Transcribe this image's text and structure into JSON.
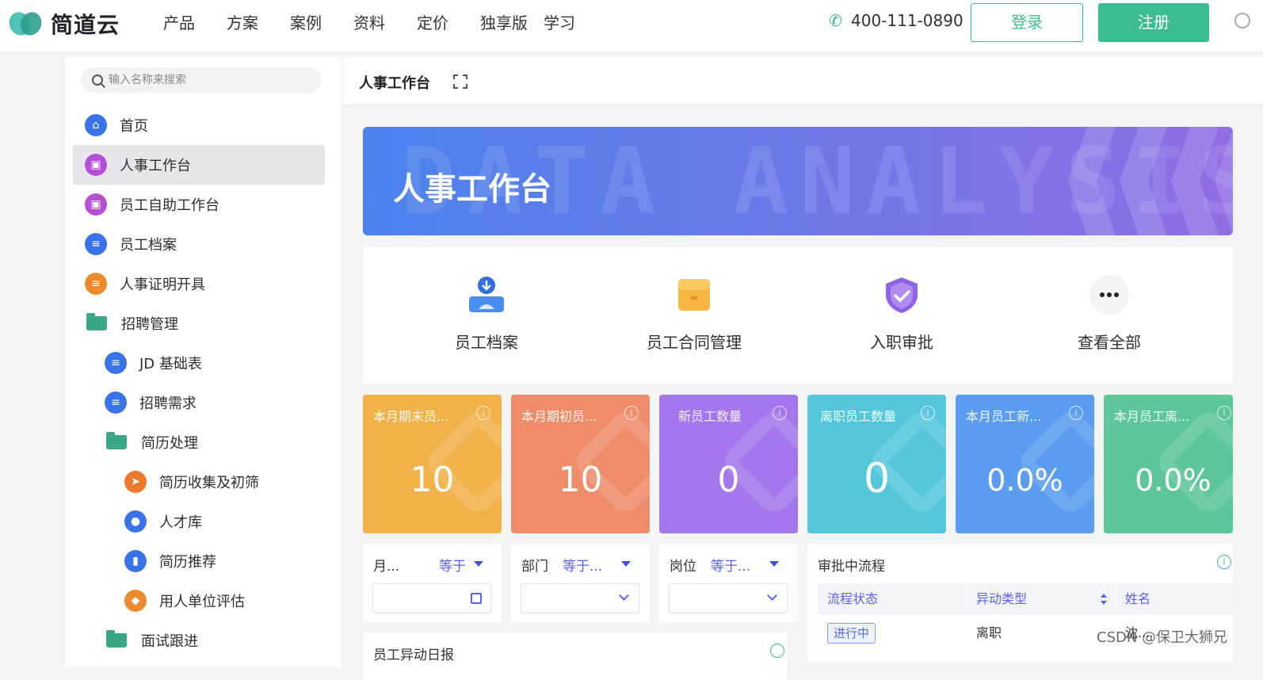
{
  "brand": {
    "name": "简道云"
  },
  "nav": [
    "产品",
    "方案",
    "案例",
    "资料",
    "定价",
    "独享版",
    "学习"
  ],
  "phone": "400-111-0890",
  "login_label": "登录",
  "register_label": "注册",
  "sidebar": {
    "search_placeholder": "输入名称来搜索",
    "items": [
      {
        "label": "首页",
        "icon": "home-icon",
        "color": "#3a73e8"
      },
      {
        "label": "人事工作台",
        "icon": "dashboard-icon",
        "color": "#b44fd6"
      },
      {
        "label": "员工自助工作台",
        "icon": "dashboard-icon",
        "color": "#b44fd6"
      },
      {
        "label": "员工档案",
        "icon": "form-icon",
        "color": "#3a73e8"
      },
      {
        "label": "人事证明开具",
        "icon": "form-icon",
        "color": "#ec8a2e"
      },
      {
        "label": "招聘管理",
        "icon": "folder-icon",
        "color": "#3aa787"
      },
      {
        "label": "JD 基础表",
        "icon": "form-icon",
        "color": "#3a73e8"
      },
      {
        "label": "招聘需求",
        "icon": "form-icon",
        "color": "#3a73e8"
      },
      {
        "label": "简历处理",
        "icon": "folder-icon",
        "color": "#3aa787"
      },
      {
        "label": "简历收集及初筛",
        "icon": "send-icon",
        "color": "#ec7a2e"
      },
      {
        "label": "人才库",
        "icon": "person-icon",
        "color": "#3a73e8"
      },
      {
        "label": "简历推荐",
        "icon": "bookmark-icon",
        "color": "#3a73e8"
      },
      {
        "label": "用人单位评估",
        "icon": "tag-icon",
        "color": "#ec8a2e"
      },
      {
        "label": "面试跟进",
        "icon": "folder-icon",
        "color": "#3aa787"
      }
    ]
  },
  "content": {
    "title": "人事工作台",
    "banner_title": "人事工作台",
    "banner_bg_text": "DATA ANALYSIS",
    "quick_links": [
      {
        "label": "员工档案",
        "icon": "download-person-icon"
      },
      {
        "label": "员工合同管理",
        "icon": "folder-box-icon"
      },
      {
        "label": "入职审批",
        "icon": "shield-check-icon"
      },
      {
        "label": "查看全部",
        "icon": "more-icon"
      }
    ],
    "metrics": [
      {
        "label": "本月期末员...",
        "value": "10",
        "color": "#f1b24a"
      },
      {
        "label": "本月期初员...",
        "value": "10",
        "color": "#ef8d6b"
      },
      {
        "label": "新员工数量",
        "value": "0",
        "color": "#a478ec"
      },
      {
        "label": "离职员工数量",
        "value": "0",
        "color": "#56c6dc"
      },
      {
        "label": "本月员工新...",
        "value": "0.0%",
        "color": "#5a9cf0"
      },
      {
        "label": "本月员工离...",
        "value": "0.0%",
        "color": "#5ec79a"
      }
    ],
    "filters": [
      {
        "label": "月...",
        "op": "等于",
        "type": "date"
      },
      {
        "label": "部门",
        "op": "等于...",
        "type": "select"
      },
      {
        "label": "岗位",
        "op": "等于...",
        "type": "select"
      }
    ],
    "approval": {
      "title": "审批中流程",
      "columns": [
        "流程状态",
        "异动类型",
        "姓名"
      ],
      "row": {
        "status": "进行中",
        "type": "离职",
        "name": "沈..."
      }
    },
    "lower_title": "员工异动日报"
  },
  "watermark": "CSDN @保卫大狮兄"
}
